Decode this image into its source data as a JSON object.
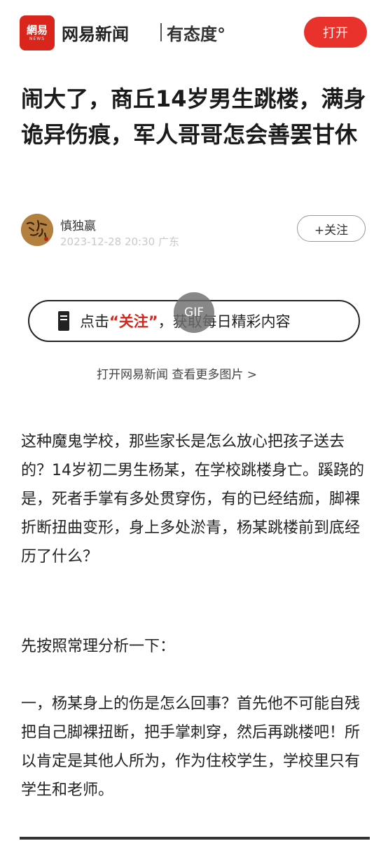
{
  "app": {
    "logo_text": "網易",
    "logo_sub": "NEWS",
    "brand": "网易新闻",
    "slogan": "有态度°",
    "open_button": "打开",
    "accent_color": "#e8322b"
  },
  "article": {
    "title": "闹大了，商丘14岁男生跳楼，满身诡异伤痕，军人哥哥怎会善罢甘休",
    "author": "慎独嬴",
    "date": "2023-12-28 20:30",
    "location": "广东",
    "follow_button": "+关注"
  },
  "promo": {
    "before": "点击",
    "quoted": "“关注”",
    "after": "，获取每日精彩内容",
    "gif_badge": "GIF"
  },
  "more_link": "打开网易新闻 查看更多图片 >",
  "paragraphs": [
    "这种魔鬼学校，那些家长是怎么放心把孩子送去的？14岁初二男生杨某，在学校跳楼身亡。蹊跷的是，死者手掌有多处贯穿伤，有的已经结痂，脚裸折断扭曲变形，身上多处淤青，杨某跳楼前到底经历了什么？",
    "先按照常理分析一下：",
    "一，杨某身上的伤是怎么回事？首先他不可能自残把自己脚裸扭断，把手掌刺穿，然后再跳楼吧！所以肯定是其他人所为，作为住校学生，学校里只有学生和老师。"
  ]
}
